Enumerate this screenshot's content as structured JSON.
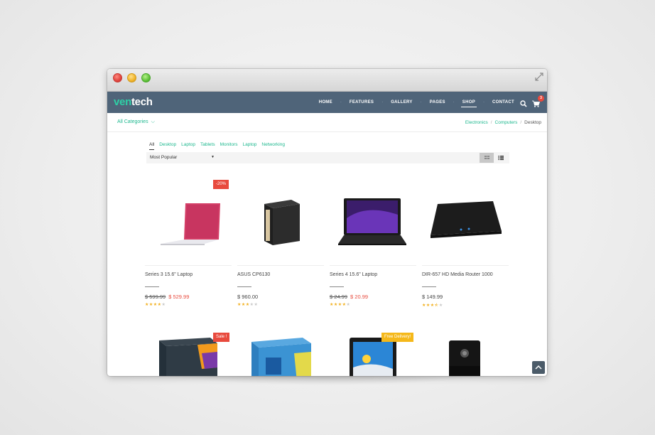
{
  "window": {
    "controls": [
      "close",
      "minimize",
      "zoom"
    ]
  },
  "navbar": {
    "logo_part1": "ven",
    "logo_part2": "tech",
    "items": [
      "HOME",
      "FEATURES",
      "GALLERY",
      "PAGES",
      "SHOP",
      "CONTACT"
    ],
    "active_item": "SHOP",
    "cart_count": "3"
  },
  "subbar": {
    "categories_label": "All Categories",
    "breadcrumb": [
      "Electronics",
      "Computers",
      "Desktop"
    ]
  },
  "filters": [
    "All",
    "Desktop",
    "Laptop",
    "Tablets",
    "Monitors",
    "Laptop",
    "Networking"
  ],
  "sort": {
    "selected": "Most Popular"
  },
  "products": [
    {
      "name": "Series 3 15.6\" Laptop",
      "old_price": "$ 599.99",
      "price": "$ 529.99",
      "rating": 4,
      "badge": "-20%",
      "image": "laptop-pink"
    },
    {
      "name": "ASUS CP6130",
      "old_price": "",
      "price": "$ 960.00",
      "rating": 3,
      "badge": "",
      "image": "desktop-tower"
    },
    {
      "name": "Series 4 15.6\" Laptop",
      "old_price": "$ 24.99",
      "price": "$ 20.99",
      "rating": 4,
      "badge": "",
      "image": "laptop-black"
    },
    {
      "name": "DIR-657 HD Media Router 1000",
      "old_price": "",
      "price": "$ 149.99",
      "rating": 3.5,
      "badge": "",
      "image": "router"
    },
    {
      "name": "",
      "old_price": "",
      "price": "",
      "rating": 0,
      "badge": "Sale !",
      "image": "cpu-box-dark"
    },
    {
      "name": "",
      "old_price": "",
      "price": "",
      "rating": 0,
      "badge": "",
      "image": "cpu-box-blue"
    },
    {
      "name": "",
      "old_price": "",
      "price": "",
      "rating": 0,
      "badge": "Free Delivery!",
      "image": "tablet"
    },
    {
      "name": "",
      "old_price": "",
      "price": "",
      "rating": 0,
      "badge": "",
      "image": "webcam"
    }
  ],
  "colors": {
    "navbar": "#4f6479",
    "accent": "#1fb88f",
    "sale": "#e84a3d",
    "badge_yellow": "#f5b81a",
    "star": "#f2b01e"
  }
}
